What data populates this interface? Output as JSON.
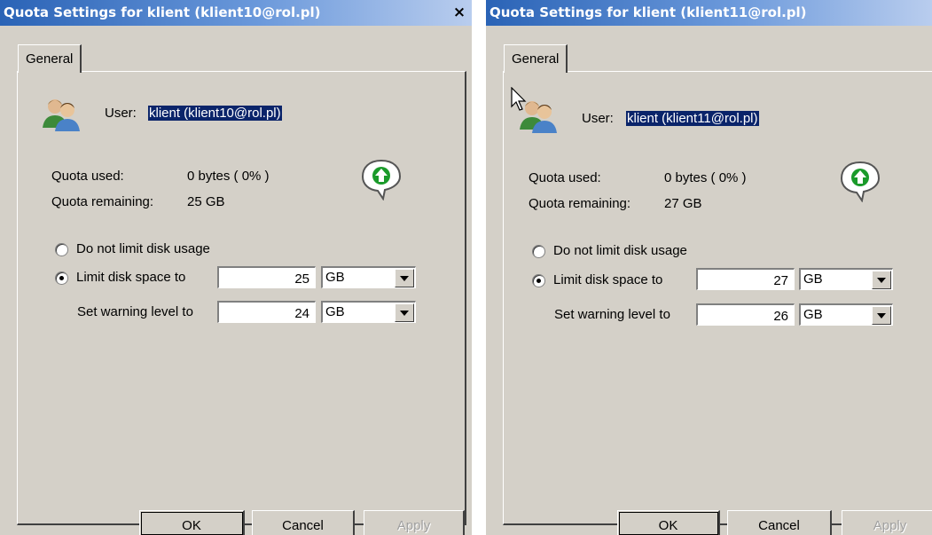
{
  "dialogs": [
    {
      "title": "Quota Settings for klient (klient10@rol.pl)",
      "close_icon": "×",
      "tab_label": "General",
      "user_label": "User:",
      "user_value": "klient (klient10@rol.pl)",
      "quota_used_label": "Quota used:",
      "quota_used_value": "0 bytes ( 0% )",
      "quota_remaining_label": "Quota remaining:",
      "quota_remaining_value": "25 GB",
      "radio_no_limit_label": "Do not limit disk usage",
      "radio_limit_label": "Limit disk space to",
      "selected_option": "limit",
      "limit_value": "25",
      "limit_unit": "GB",
      "warning_label": "Set warning level to",
      "warning_value": "24",
      "warning_unit": "GB",
      "ok_label": "OK",
      "cancel_label": "Cancel",
      "apply_label": "Apply"
    },
    {
      "title": "Quota Settings for klient (klient11@rol.pl)",
      "tab_label": "General",
      "user_label": "User:",
      "user_value": "klient (klient11@rol.pl)",
      "quota_used_label": "Quota used:",
      "quota_used_value": "0 bytes ( 0% )",
      "quota_remaining_label": "Quota remaining:",
      "quota_remaining_value": "27 GB",
      "radio_no_limit_label": "Do not limit disk usage",
      "radio_limit_label": "Limit disk space to",
      "selected_option": "limit",
      "limit_value": "27",
      "limit_unit": "GB",
      "warning_label": "Set warning level to",
      "warning_value": "26",
      "warning_unit": "GB",
      "ok_label": "OK",
      "cancel_label": "Cancel",
      "apply_label": "Apply"
    }
  ],
  "icons": {
    "user": "users-icon",
    "quota_bubble": "up-arrow-speech-bubble-icon",
    "cursor": "mouse-pointer-icon"
  },
  "colors": {
    "titlebar_start": "#2a63b6",
    "selection": "#0a246a",
    "arrow_green": "#1a9a2a",
    "dialog_bg": "#d4d0c8"
  }
}
